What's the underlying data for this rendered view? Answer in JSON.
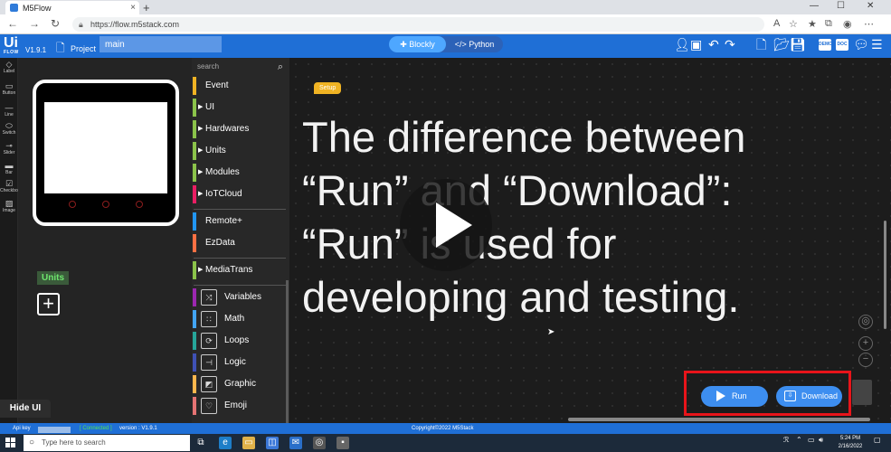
{
  "browser": {
    "tab_title": "M5Flow",
    "tab_close": "×",
    "new_tab": "+",
    "url": "https://flow.m5stack.com",
    "win_min": "—",
    "win_max": "☐",
    "win_close": "✕"
  },
  "header": {
    "logo_main": "Ui",
    "logo_sub": "FLOW",
    "version": "V1.9.1",
    "project_label": "Project",
    "project_name": "main",
    "mode_blockly": "Blockly",
    "mode_python": "</> Python",
    "badge_demo": "DEMO",
    "badge_doc": "DOC"
  },
  "rail": {
    "items": [
      "Label",
      "Button",
      "Line",
      "Switch",
      "Slider",
      "Bar",
      "Checkbox",
      "Image"
    ]
  },
  "device_area": {
    "units_label": "Units",
    "add_unit": "+",
    "hide_ui": "Hide UI"
  },
  "categories": {
    "search_placeholder": "search",
    "items": [
      {
        "label": "Event",
        "color": "#f0b323"
      },
      {
        "label": "UI",
        "color": "#8bc34a"
      },
      {
        "label": "Hardwares",
        "color": "#8bc34a"
      },
      {
        "label": "Units",
        "color": "#8bc34a"
      },
      {
        "label": "Modules",
        "color": "#8bc34a"
      },
      {
        "label": "IoTCloud",
        "color": "#e91e63"
      },
      {
        "label": "Remote+",
        "color": "#2196f3"
      },
      {
        "label": "EzData",
        "color": "#ff7043"
      },
      {
        "label": "MediaTrans",
        "color": "#8bc34a"
      },
      {
        "label": "Variables",
        "color": "#9c27b0"
      },
      {
        "label": "Math",
        "color": "#42a5f5"
      },
      {
        "label": "Loops",
        "color": "#26a69a"
      },
      {
        "label": "Logic",
        "color": "#3f51b5"
      },
      {
        "label": "Graphic",
        "color": "#ffb74d"
      },
      {
        "label": "Emoji",
        "color": "#e57373"
      }
    ]
  },
  "workspace": {
    "setup_block": "Setup",
    "caption_lines": [
      "The difference between",
      "“Run” and “Download”:",
      "“Run” is used for",
      "developing and testing."
    ],
    "run_label": "Run",
    "download_label": "Download",
    "highlight_color": "#e8141a"
  },
  "statusbar": {
    "api_key_label": "Api key",
    "connected": "[ Connected ]",
    "version": "version : V1.9.1",
    "copyright": "Copyright©2022 M5Stack"
  },
  "taskbar": {
    "search_placeholder": "Type here to search",
    "time": "5:24 PM",
    "date": "2/16/2022"
  },
  "colors": {
    "accent": "#1f6fd6",
    "button": "#3d8ef0",
    "workspace_bg": "#1c1c1c"
  }
}
